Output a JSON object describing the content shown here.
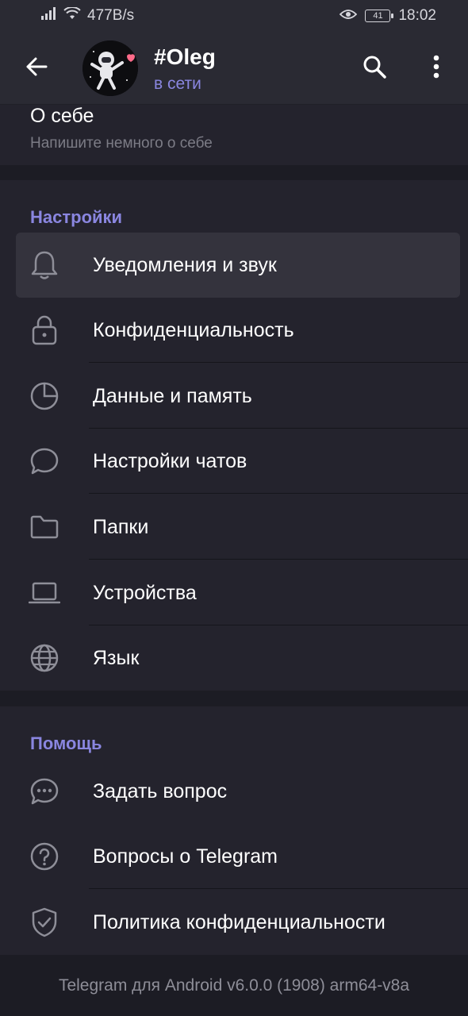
{
  "status_bar": {
    "speed": "477B/s",
    "battery": "41",
    "time": "18:02"
  },
  "header": {
    "title": "#Oleg",
    "subtitle": "в сети"
  },
  "about": {
    "label": "О себе",
    "hint": "Напишите немного о себе"
  },
  "settings": {
    "title": "Настройки",
    "items": [
      {
        "label": "Уведомления и звук",
        "icon": "bell-icon"
      },
      {
        "label": "Конфиденциальность",
        "icon": "lock-icon"
      },
      {
        "label": "Данные и память",
        "icon": "pie-chart-icon"
      },
      {
        "label": "Настройки чатов",
        "icon": "chat-bubble-icon"
      },
      {
        "label": "Папки",
        "icon": "folder-icon"
      },
      {
        "label": "Устройства",
        "icon": "laptop-icon"
      },
      {
        "label": "Язык",
        "icon": "globe-icon"
      }
    ]
  },
  "help": {
    "title": "Помощь",
    "items": [
      {
        "label": "Задать вопрос",
        "icon": "chat-dots-icon"
      },
      {
        "label": "Вопросы о Telegram",
        "icon": "question-icon"
      },
      {
        "label": "Политика конфиденциальности",
        "icon": "shield-check-icon"
      }
    ]
  },
  "footer": {
    "version": "Telegram для Android v6.0.0 (1908) arm64-v8a"
  },
  "colors": {
    "accent": "#8a86e0",
    "background": "#1c1c24",
    "surface": "#24232d",
    "header": "#2a2a33"
  }
}
